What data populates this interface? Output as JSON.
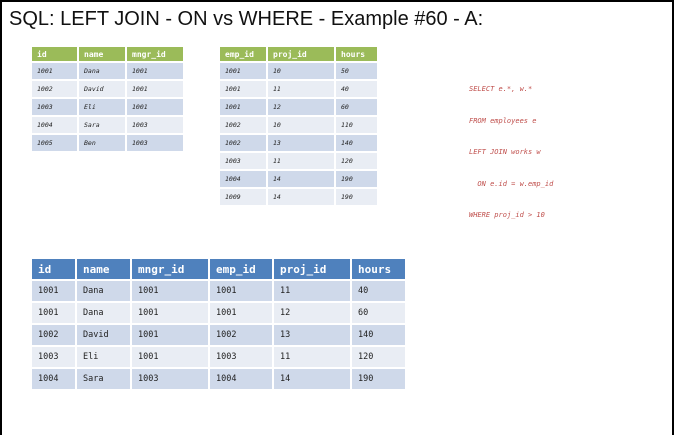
{
  "title": "SQL: LEFT JOIN - ON vs WHERE - Example #60 - A:",
  "employees": {
    "columns": [
      "id",
      "name",
      "mngr_id"
    ],
    "rows": [
      [
        "1001",
        "Dana",
        "1001"
      ],
      [
        "1002",
        "David",
        "1001"
      ],
      [
        "1003",
        "Eli",
        "1001"
      ],
      [
        "1004",
        "Sara",
        "1003"
      ],
      [
        "1005",
        "Ben",
        "1003"
      ]
    ]
  },
  "works": {
    "columns": [
      "emp_id",
      "proj_id",
      "hours"
    ],
    "rows": [
      [
        "1001",
        "10",
        "50"
      ],
      [
        "1001",
        "11",
        "40"
      ],
      [
        "1001",
        "12",
        "60"
      ],
      [
        "1002",
        "10",
        "110"
      ],
      [
        "1002",
        "13",
        "140"
      ],
      [
        "1003",
        "11",
        "120"
      ],
      [
        "1004",
        "14",
        "190"
      ],
      [
        "1009",
        "14",
        "190"
      ]
    ]
  },
  "sql_lines": [
    "SELECT e.*, w.*",
    "FROM employees e",
    "LEFT JOIN works w",
    "  ON e.id = w.emp_id",
    "WHERE proj_id > 10"
  ],
  "result": {
    "columns": [
      "id",
      "name",
      "mngr_id",
      "emp_id",
      "proj_id",
      "hours"
    ],
    "rows": [
      [
        "1001",
        "Dana",
        "1001",
        "1001",
        "11",
        "40"
      ],
      [
        "1001",
        "Dana",
        "1001",
        "1001",
        "12",
        "60"
      ],
      [
        "1002",
        "David",
        "1001",
        "1002",
        "13",
        "140"
      ],
      [
        "1003",
        "Eli",
        "1001",
        "1003",
        "11",
        "120"
      ],
      [
        "1004",
        "Sara",
        "1003",
        "1004",
        "14",
        "190"
      ]
    ]
  }
}
